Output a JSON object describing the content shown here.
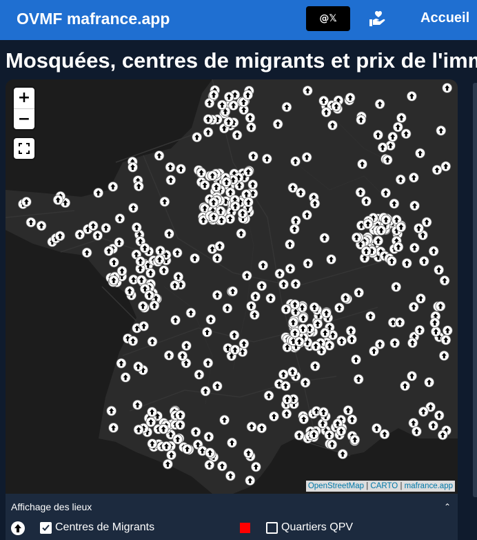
{
  "header": {
    "brand": "OVMF mafrance.app",
    "x_button_label": "@𝕏",
    "home_label": "Accueil",
    "donate_icon": "hand-heart-icon"
  },
  "page": {
    "title": "Mosquées, centres de migrants et prix de l'immobilier"
  },
  "map": {
    "zoom_in_label": "+",
    "zoom_out_label": "−",
    "fullscreen_icon": "fullscreen-icon",
    "marker_icon": "arrow-up-icon",
    "attribution": {
      "osm": "OpenStreetMap",
      "carto": "CARTO",
      "app": "mafrance.app",
      "separator": "|"
    },
    "colors": {
      "background": "#262626",
      "sea": "#1b1b1b",
      "land": "#2a2a2a",
      "marker": "#ffffff"
    }
  },
  "display_panel": {
    "title": "Affichage des lieux",
    "collapse_icon": "chevron-up-icon",
    "layers": [
      {
        "label": "Centres de Migrants",
        "checked": true,
        "icon": "arrow-up-icon"
      },
      {
        "label": "Quartiers QPV",
        "checked": false,
        "swatch_color": "#ff0000"
      }
    ]
  }
}
